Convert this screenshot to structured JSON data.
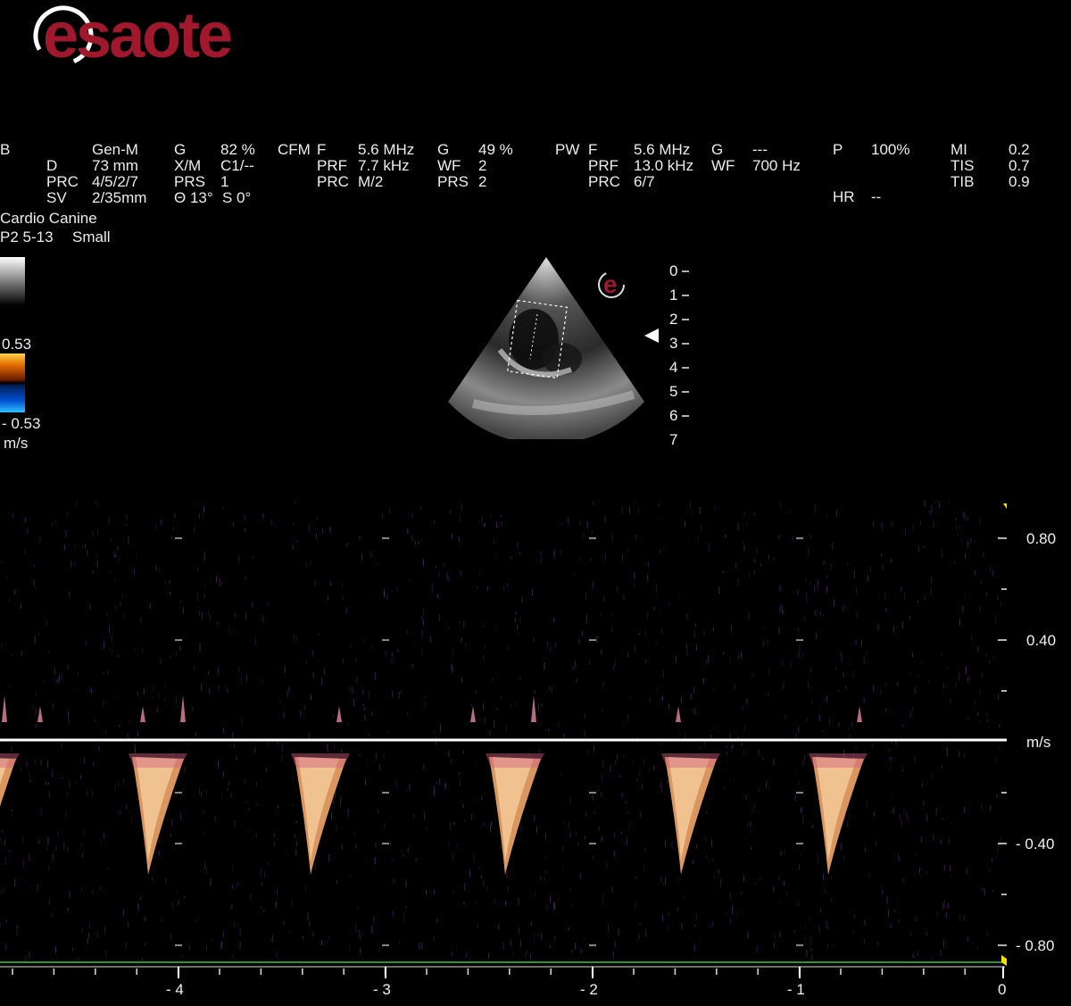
{
  "brand": {
    "logo_text": "esaote",
    "logo_color": "#a0182c"
  },
  "header": {
    "b": {
      "label": "B",
      "preset": "Gen-M",
      "rows": [
        [
          "D",
          "73 mm"
        ],
        [
          "PRC",
          "4/5/2/7"
        ],
        [
          "SV",
          "2/35mm"
        ]
      ]
    },
    "g_col": {
      "rows": [
        [
          "G",
          "82 %"
        ],
        [
          "X/M",
          "C1/--"
        ],
        [
          "PRS",
          "1"
        ],
        [
          "Θ 13°",
          "S 0°"
        ]
      ]
    },
    "cfm": {
      "label": "CFM",
      "rows": [
        [
          "F",
          "5.6 MHz"
        ],
        [
          "PRF",
          "7.7 kHz"
        ],
        [
          "PRC",
          "M/2"
        ]
      ]
    },
    "cfm_g": {
      "rows": [
        [
          "G",
          "49 %"
        ],
        [
          "WF",
          "2"
        ],
        [
          "PRS",
          "2"
        ]
      ]
    },
    "pw": {
      "label": "PW",
      "rows": [
        [
          "F",
          "5.6 MHz"
        ],
        [
          "PRF",
          "13.0 kHz"
        ],
        [
          "PRC",
          "6/7"
        ]
      ]
    },
    "pw_g": {
      "rows": [
        [
          "G",
          "---"
        ],
        [
          "WF",
          "700 Hz"
        ]
      ]
    },
    "power": {
      "rows": [
        [
          "P",
          "100%"
        ],
        [
          "HR",
          "--"
        ]
      ]
    },
    "indices": {
      "rows": [
        [
          "MI",
          "0.2"
        ],
        [
          "TIS",
          "0.7"
        ],
        [
          "TIB",
          "0.9"
        ]
      ]
    }
  },
  "exam": {
    "preset": "Cardio Canine",
    "probe": "P2 5-13",
    "size": "Small"
  },
  "color_scale": {
    "top": "0.53",
    "bottom": "- 0.53",
    "unit": "m/s"
  },
  "depth_scale": [
    "0",
    "1",
    "2",
    "3",
    "4",
    "5",
    "6",
    "7"
  ],
  "spectral": {
    "y_ticks": [
      "0.80",
      "0.40",
      "m/s",
      "- 0.40",
      "- 0.80"
    ],
    "x_ticks": [
      "- 4",
      "- 3",
      "- 2",
      "- 1",
      "0"
    ],
    "baseline_color": "#ffffff",
    "sweep_color": "#37c837",
    "signal_color": "#ffb070"
  }
}
